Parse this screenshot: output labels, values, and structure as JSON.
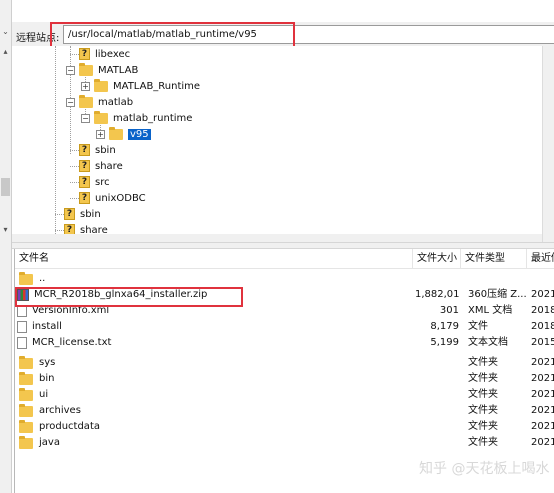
{
  "remote_site": {
    "label": "远程站点:",
    "path": "/usr/local/matlab/matlab_runtime/v95"
  },
  "tree": [
    {
      "label": "libexec",
      "icon": "question-folder-icon",
      "expander": ""
    },
    {
      "label": "MATLAB",
      "icon": "folder-icon",
      "expander": "−"
    },
    {
      "label": "MATLAB_Runtime",
      "icon": "folder-icon",
      "expander": "+"
    },
    {
      "label": "matlab",
      "icon": "folder-icon",
      "expander": "−"
    },
    {
      "label": "matlab_runtime",
      "icon": "folder-icon",
      "expander": "−"
    },
    {
      "label": "v95",
      "icon": "folder-icon",
      "expander": "+",
      "selected": true
    },
    {
      "label": "sbin",
      "icon": "question-folder-icon",
      "expander": ""
    },
    {
      "label": "share",
      "icon": "question-folder-icon",
      "expander": ""
    },
    {
      "label": "src",
      "icon": "question-folder-icon",
      "expander": ""
    },
    {
      "label": "unixODBC",
      "icon": "question-folder-icon",
      "expander": ""
    },
    {
      "label": "sbin",
      "icon": "question-folder-icon",
      "expander": ""
    },
    {
      "label": "share",
      "icon": "question-folder-icon",
      "expander": ""
    }
  ],
  "columns": {
    "name": "文件名",
    "size": "文件大小",
    "type": "文件类型",
    "modified": "最近修"
  },
  "files": [
    {
      "name": "..",
      "size": "",
      "type": "",
      "modified": "",
      "icon": "folder-icon"
    },
    {
      "name": "MCR_R2018b_glnxa64_installer.zip",
      "size": "1,882,01...",
      "type": "360压缩 Z...",
      "modified": "2021",
      "icon": "zip-icon"
    },
    {
      "name": "VersionInfo.xml",
      "size": "301",
      "type": "XML 文档",
      "modified": "2018",
      "icon": "doc-icon"
    },
    {
      "name": "install",
      "size": "8,179",
      "type": "文件",
      "modified": "2018",
      "icon": "doc-icon"
    },
    {
      "name": "MCR_license.txt",
      "size": "5,199",
      "type": "文本文档",
      "modified": "2015",
      "icon": "doc-icon"
    },
    {
      "name": "sys",
      "size": "",
      "type": "文件夹",
      "modified": "2021",
      "icon": "folder-icon"
    },
    {
      "name": "bin",
      "size": "",
      "type": "文件夹",
      "modified": "2021",
      "icon": "folder-icon"
    },
    {
      "name": "ui",
      "size": "",
      "type": "文件夹",
      "modified": "2021",
      "icon": "folder-icon"
    },
    {
      "name": "archives",
      "size": "",
      "type": "文件夹",
      "modified": "2021",
      "icon": "folder-icon"
    },
    {
      "name": "productdata",
      "size": "",
      "type": "文件夹",
      "modified": "2021",
      "icon": "folder-icon"
    },
    {
      "name": "java",
      "size": "",
      "type": "文件夹",
      "modified": "2021",
      "icon": "folder-icon"
    }
  ],
  "watermark": "知乎 @天花板上喝水",
  "colors": {
    "highlight_box": "#e0323d",
    "selection": "#0a63c9",
    "folder": "#f3c64e"
  }
}
